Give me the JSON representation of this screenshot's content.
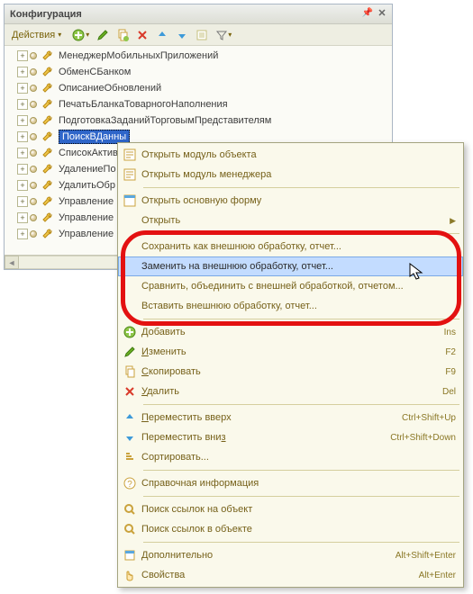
{
  "title": "Конфигурация",
  "toolbar": {
    "actions": "Действия"
  },
  "tree": [
    {
      "label": "МенеджерМобильныхПриложений",
      "selected": false
    },
    {
      "label": "ОбменСБанком",
      "selected": false
    },
    {
      "label": "ОписаниеОбновлений",
      "selected": false
    },
    {
      "label": "ПечатьБланкаТоварногоНаполнения",
      "selected": false
    },
    {
      "label": "ПодготовкаЗаданийТорговымПредставителям",
      "selected": false
    },
    {
      "label": "ПоискВДанны",
      "selected": true
    },
    {
      "label": "СписокАктив",
      "selected": false
    },
    {
      "label": "УдалениеПо",
      "selected": false
    },
    {
      "label": "УдалитьОбр",
      "selected": false
    },
    {
      "label": "Управление",
      "selected": false
    },
    {
      "label": "Управление",
      "selected": false
    },
    {
      "label": "Управление",
      "selected": false
    }
  ],
  "menu": {
    "open_module": "Открыть модуль объекта",
    "open_mgr_module": "Открыть модуль менеджера",
    "open_main_form": "Открыть основную форму",
    "open": "Открыть",
    "save_external": "Сохранить как внешнюю обработку, отчет...",
    "replace_external": "Заменить на внешнюю обработку, отчет...",
    "compare_merge": "Сравнить, объединить с внешней обработкой, отчетом...",
    "insert_external": "Вставить внешнюю обработку, отчет...",
    "add": "Добавить",
    "edit": "Изменить",
    "copy": "Скопировать",
    "delete": "Удалить",
    "move_up": "Переместить вверх",
    "move_down": "Переместить вниз",
    "sort": "Сортировать...",
    "help": "Справочная информация",
    "find_refs_to": "Поиск ссылок на объект",
    "find_refs_in": "Поиск ссылок в объекте",
    "additional": "Дополнительно",
    "properties": "Свойства"
  },
  "shortcuts": {
    "add": "Ins",
    "edit": "F2",
    "copy": "F9",
    "delete": "Del",
    "move_up": "Ctrl+Shift+Up",
    "move_down": "Ctrl+Shift+Down",
    "additional": "Alt+Shift+Enter",
    "properties": "Alt+Enter"
  }
}
